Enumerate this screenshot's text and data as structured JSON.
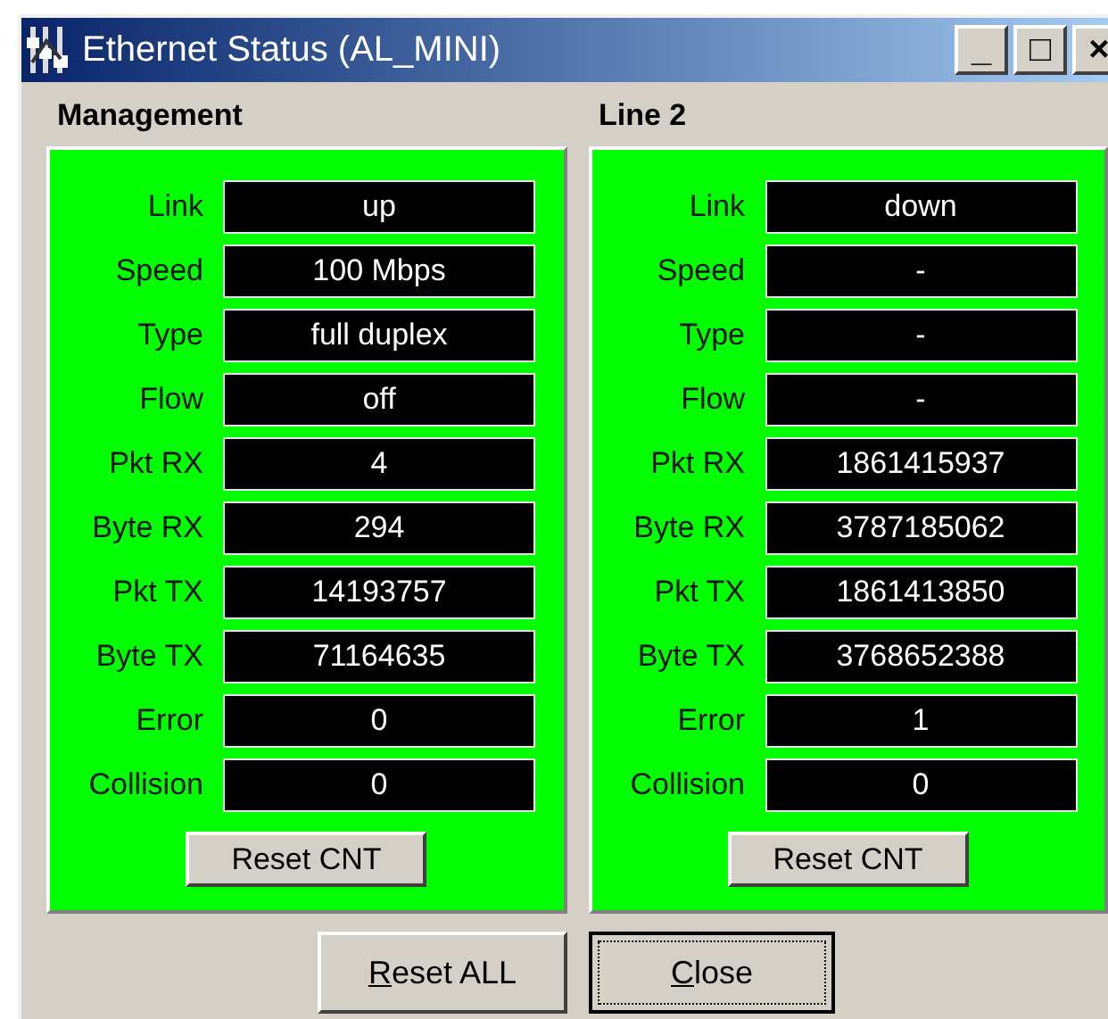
{
  "window": {
    "title": "Ethernet Status (AL_MINI)",
    "controls": [
      "_",
      "□",
      "×"
    ]
  },
  "panels": [
    {
      "title": "Management",
      "rows": [
        {
          "label": "Link",
          "value": "up"
        },
        {
          "label": "Speed",
          "value": "100 Mbps"
        },
        {
          "label": "Type",
          "value": "full duplex"
        },
        {
          "label": "Flow",
          "value": "off"
        },
        {
          "label": "Pkt RX",
          "value": "4"
        },
        {
          "label": "Byte RX",
          "value": "294"
        },
        {
          "label": "Pkt TX",
          "value": "14193757"
        },
        {
          "label": "Byte TX",
          "value": "71164635"
        },
        {
          "label": "Error",
          "value": "0"
        },
        {
          "label": "Collision",
          "value": "0"
        }
      ],
      "button": "Reset CNT"
    },
    {
      "title": "Line 2",
      "rows": [
        {
          "label": "Link",
          "value": "down"
        },
        {
          "label": "Speed",
          "value": "-"
        },
        {
          "label": "Type",
          "value": "-"
        },
        {
          "label": "Flow",
          "value": "-"
        },
        {
          "label": "Pkt RX",
          "value": "1861415937"
        },
        {
          "label": "Byte RX",
          "value": "3787185062"
        },
        {
          "label": "Pkt TX",
          "value": "1861413850"
        },
        {
          "label": "Byte TX",
          "value": "3768652388"
        },
        {
          "label": "Error",
          "value": "1"
        },
        {
          "label": "Collision",
          "value": "0"
        }
      ],
      "button": "Reset CNT"
    }
  ],
  "buttons": [
    {
      "label": "Reset ALL",
      "mnemonic": true,
      "focused": false
    },
    {
      "label": "Close",
      "mnemonic": true,
      "focused": true
    }
  ]
}
